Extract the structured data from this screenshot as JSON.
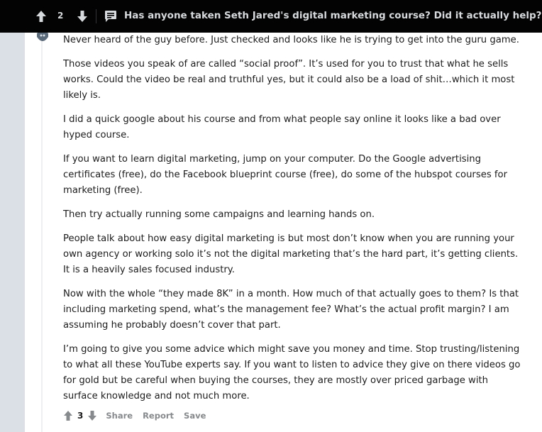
{
  "header": {
    "vote_count": "2",
    "post_title": "Has anyone taken Seth Jared's digital marketing course? Did it actually help?"
  },
  "comment": {
    "paragraphs": [
      "Never heard of the guy before. Just checked and looks like he is trying to get into the guru game.",
      "Those videos you speak of are called “social proof”. It’s used for you to trust that what he sells works. Could the video be real and truthful yes, but it could also be a load of shit…which it most likely is.",
      "I did a quick google about his course and from what people say online it looks like a bad over hyped course.",
      "If you want to learn digital marketing, jump on your computer. Do the Google advertising certificates (free), do the Facebook blueprint course (free), do some of the hubspot courses for marketing (free).",
      "Then try actually running some campaigns and learning hands on.",
      "People talk about how easy digital marketing is but most don’t know when you are running your own agency or working solo it’s not the digital marketing that’s the hard part, it’s getting clients. It is a heavily sales focused industry.",
      "Now with the whole “they made 8K” in a month. How much of that actually goes to them? Is that including marketing spend, what’s the management fee? What’s the actual profit margin? I am assuming he probably doesn’t cover that part.",
      "I’m going to give you some advice which might save you money and time. Stop trusting/listening to what all these YouTube experts say. If you want to listen to advice they give on there videos go for gold but be careful when buying the courses, they are mostly over priced garbage with surface knowledge and not much more."
    ]
  },
  "actions": {
    "vote_count": "3",
    "share_label": "Share",
    "report_label": "Report",
    "save_label": "Save"
  },
  "icons": {
    "upvote": "arrow-up-icon",
    "downvote": "arrow-down-icon",
    "comment": "comment-icon"
  },
  "colors": {
    "header_bg": "#030303",
    "page_bg": "#dae0e6",
    "text": "#1c1c1c",
    "muted": "#878a8c"
  }
}
